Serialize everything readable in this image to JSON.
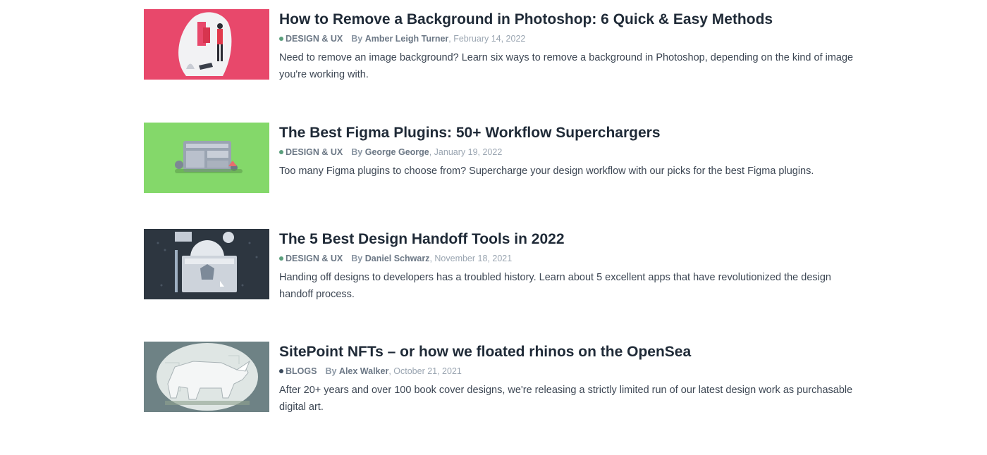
{
  "articles": [
    {
      "title": "How to Remove a Background in Photoshop: 6 Quick & Easy Methods",
      "category": "DESIGN & UX",
      "category_color": "#5a9e7c",
      "by": "By",
      "author": "Amber Leigh Turner",
      "date": ", February 14, 2022",
      "excerpt": "Need to remove an image background? Learn six ways to remove a background in Photoshop, depending on the kind of image you're working with.",
      "thumb_bg": "#e8486b"
    },
    {
      "title": "The Best Figma Plugins: 50+ Workflow Superchargers",
      "category": "DESIGN & UX",
      "category_color": "#5a9e7c",
      "by": "By",
      "author": "George George",
      "date": ", January 19, 2022",
      "excerpt": "Too many Figma plugins to choose from? Supercharge your design workflow with our picks for the best Figma plugins.",
      "thumb_bg": "#84d86a"
    },
    {
      "title": "The 5 Best Design Handoff Tools in 2022",
      "category": "DESIGN & UX",
      "category_color": "#5a9e7c",
      "by": "By",
      "author": "Daniel Schwarz",
      "date": ", November 18, 2021",
      "excerpt": "Handing off designs to developers has a troubled history. Learn about 5 excellent apps that have revolutionized the design handoff process.",
      "thumb_bg": "#2d3640"
    },
    {
      "title": "SitePoint NFTs – or how we floated rhinos on the OpenSea",
      "category": "BLOGS",
      "category_color": "#3b4a5c",
      "by": "By",
      "author": "Alex Walker",
      "date": ", October 21, 2021",
      "excerpt": "After 20+ years and over 100 book cover designs, we're releasing a strictly limited run of our latest design work as purchasable digital art.",
      "thumb_bg": "#6e8285"
    }
  ]
}
